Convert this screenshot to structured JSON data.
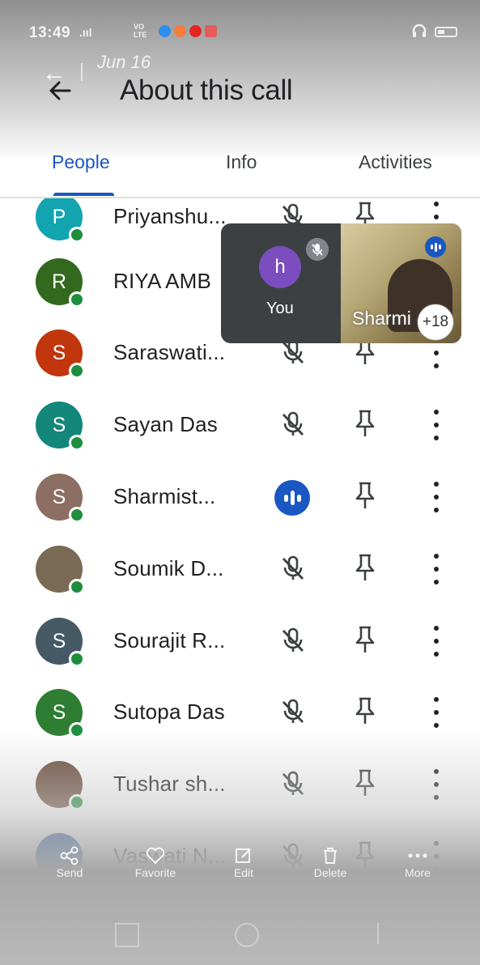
{
  "status_bar": {
    "time": "13:49",
    "signal": ".ııl",
    "network": "VO\nLTE"
  },
  "ghost": {
    "date": "Jun 16"
  },
  "header": {
    "title": "About this call"
  },
  "tabs": [
    {
      "label": "People",
      "active": true
    },
    {
      "label": "Info",
      "active": false
    },
    {
      "label": "Activities",
      "active": false
    }
  ],
  "participants": [
    {
      "initial": "P",
      "name": "Priyanshu...",
      "color": "#12a4af",
      "mic": "muted"
    },
    {
      "initial": "R",
      "name": "RIYA AMB",
      "color": "#33691e",
      "mic": "hidden"
    },
    {
      "initial": "S",
      "name": "Saraswati...",
      "color": "#c1360d",
      "mic": "muted"
    },
    {
      "initial": "S",
      "name": "Sayan Das",
      "color": "#12877a",
      "mic": "muted"
    },
    {
      "initial": "S",
      "name": "Sharmist...",
      "color": "#8d6e63",
      "mic": "speaking"
    },
    {
      "initial": "",
      "name": "Soumik D...",
      "color": "#7a6a55",
      "mic": "muted"
    },
    {
      "initial": "S",
      "name": "Sourajit R...",
      "color": "#455a64",
      "mic": "muted"
    },
    {
      "initial": "S",
      "name": "Sutopa Das",
      "color": "#2f7d32",
      "mic": "muted"
    },
    {
      "initial": "",
      "name": "Tushar sh...",
      "color": "#6b4b3a",
      "mic": "muted"
    },
    {
      "initial": "",
      "name": "Vaswati N...",
      "color": "#0d47a1",
      "mic": "muted"
    }
  ],
  "floating_window": {
    "self_initial": "h",
    "self_label": "You",
    "video_name": "Sharmi",
    "more_count": "+18"
  },
  "gallery_bar": [
    {
      "label": "Send",
      "icon": "share-icon"
    },
    {
      "label": "Favorite",
      "icon": "heart-icon"
    },
    {
      "label": "Edit",
      "icon": "edit-icon"
    },
    {
      "label": "Delete",
      "icon": "trash-icon"
    },
    {
      "label": "More",
      "icon": "more-horizontal-icon"
    }
  ]
}
